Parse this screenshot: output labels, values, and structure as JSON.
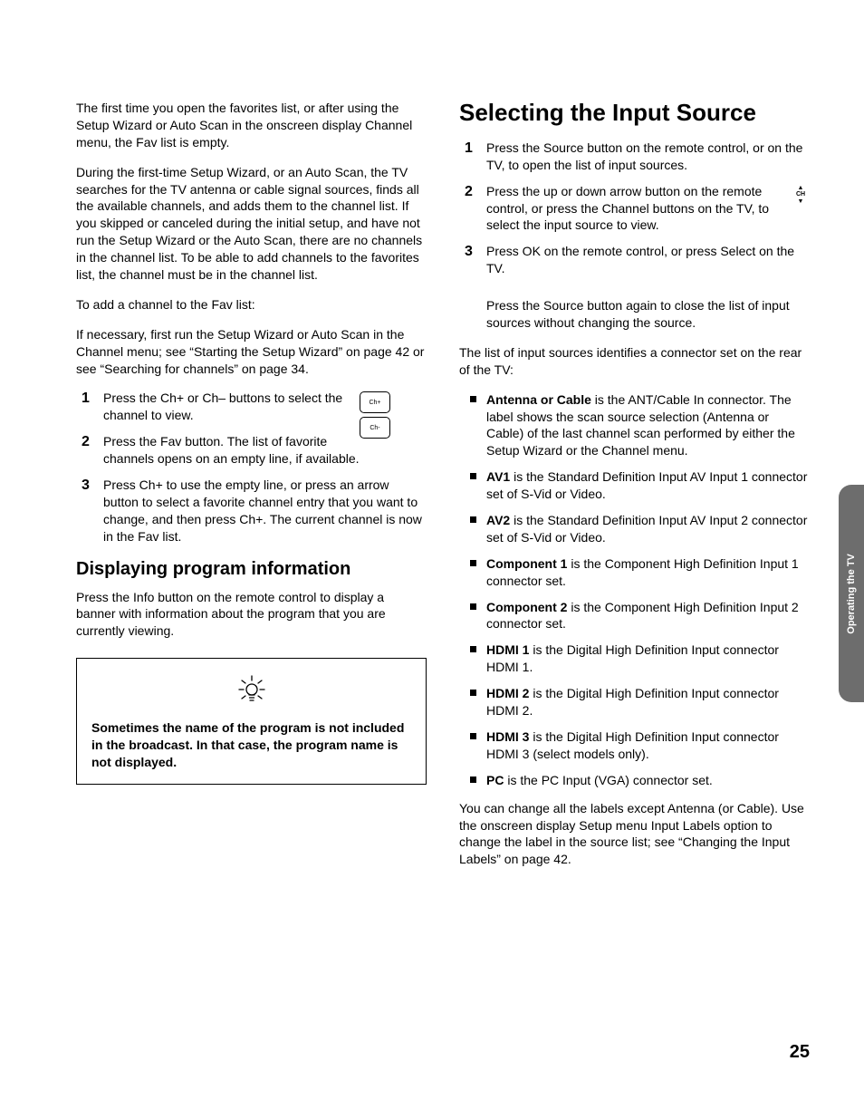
{
  "left": {
    "p1": "The first time you open the favorites list, or after using the Setup Wizard or Auto Scan in the onscreen display Channel menu, the Fav list is empty.",
    "p2": "During the first-time Setup Wizard, or an Auto Scan, the TV searches for the TV antenna or cable signal sources, finds all the available channels, and adds them to the channel list. If you skipped or canceled during the initial setup, and have not run the Setup Wizard or the Auto Scan, there are no channels in the channel list. To be able to add channels to the favorites list, the channel must be in the channel list.",
    "p3": "To add a channel to the Fav list:",
    "p4": "If necessary, first run the Setup Wizard or Auto Scan in the Channel menu; see “Starting the Setup Wizard” on page 42 or see “Searching for channels” on page 34.",
    "steps": [
      "Press the Ch+ or Ch– buttons to select the channel to view.",
      "Press the Fav button. The list of favorite channels opens on an empty line, if available.",
      "Press Ch+ to use the empty line, or press an arrow button to select a favorite channel entry that you want to change, and then press Ch+. The current channel is now in the Fav list."
    ],
    "btn_chplus": "Ch+",
    "btn_chminus": "Ch-",
    "h2": "Displaying program information",
    "p5": "Press the Info button on the remote control to display a banner with information about the program that you are currently viewing.",
    "tip": "Sometimes the name of the program is not included in the broadcast. In that case, the program name is not displayed."
  },
  "right": {
    "h1": "Selecting the Input Source",
    "steps": [
      "Press the Source button on the remote control, or on the TV, to open the list of input sources.",
      "Press the up or down arrow button on the remote control, or press the Channel buttons on the TV, to select the input source to view.",
      "Press OK on the remote control, or press Select on the TV."
    ],
    "ch_label": "CH",
    "p_after_steps": "Press the Source button again to close the list of input sources without changing the source.",
    "p_list_intro": "The list of input sources identifies a connector set on the rear of the TV:",
    "bullets": [
      {
        "b": "Antenna or Cable",
        "t": " is the ANT/Cable In connector. The label shows the scan source selection (Antenna or Cable) of the last channel scan performed by either the Setup Wizard or the Channel menu."
      },
      {
        "b": "AV1",
        "t": " is the Standard Definition Input AV Input 1 connector set of S-Vid or Video."
      },
      {
        "b": "AV2",
        "t": " is the Standard Definition Input AV Input 2 connector set of S-Vid or Video."
      },
      {
        "b": "Component 1",
        "t": " is the Component High Definition Input 1 connector set."
      },
      {
        "b": "Component 2",
        "t": " is the Component High Definition Input 2 connector set."
      },
      {
        "b": "HDMI 1",
        "t": " is the Digital High Definition Input connector HDMI 1."
      },
      {
        "b": "HDMI 2",
        "t": " is the Digital High Definition Input connector HDMI 2."
      },
      {
        "b": "HDMI 3",
        "t": " is the Digital High Definition Input connector HDMI 3 (select models only)."
      },
      {
        "b": "PC",
        "t": " is the PC Input (VGA) connector set."
      }
    ],
    "p_last": "You can change all the labels except Antenna (or Cable). Use the onscreen display Setup menu Input Labels option to change the label in the source list; see “Changing the Input Labels” on page 42."
  },
  "side_tab": "Operating the TV",
  "page_number": "25"
}
